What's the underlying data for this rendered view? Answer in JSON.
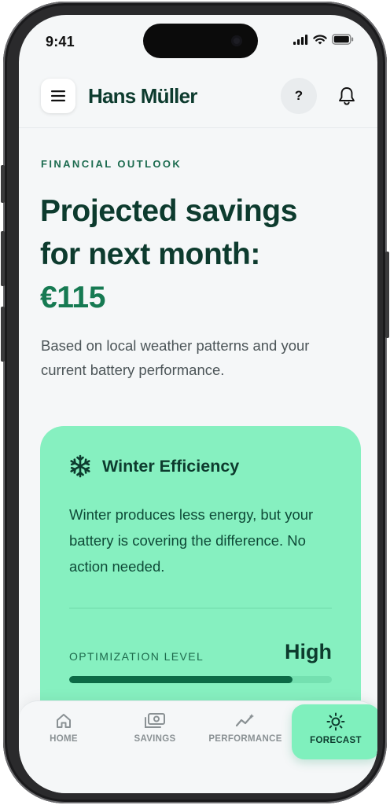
{
  "status_bar": {
    "time": "9:41"
  },
  "header": {
    "title": "Hans Müller",
    "help_label": "?"
  },
  "outlook": {
    "eyebrow": "FINANCIAL OUTLOOK",
    "headline_line1": "Projected savings",
    "headline_line2": "for next month:",
    "amount": "€115",
    "description": "Based on local weather patterns and your current battery performance."
  },
  "card": {
    "icon": "snowflake-icon",
    "title": "Winter Efficiency",
    "body": "Winter produces less energy, but your battery is covering the difference. No action needed.",
    "optimization_label": "OPTIMIZATION LEVEL",
    "optimization_value": "High",
    "optimization_progress": 0.85
  },
  "nav": [
    {
      "label": "HOME",
      "icon": "home-icon",
      "active": false
    },
    {
      "label": "SAVINGS",
      "icon": "banknote-icon",
      "active": false
    },
    {
      "label": "PERFORMANCE",
      "icon": "chart-line-icon",
      "active": false
    },
    {
      "label": "FORECAST",
      "icon": "sun-icon",
      "active": true
    }
  ],
  "colors": {
    "brand_dark": "#0d3b2e",
    "accent_green": "#167a52",
    "card_bg": "#86f0c0",
    "progress_fill": "#0c6a46"
  }
}
